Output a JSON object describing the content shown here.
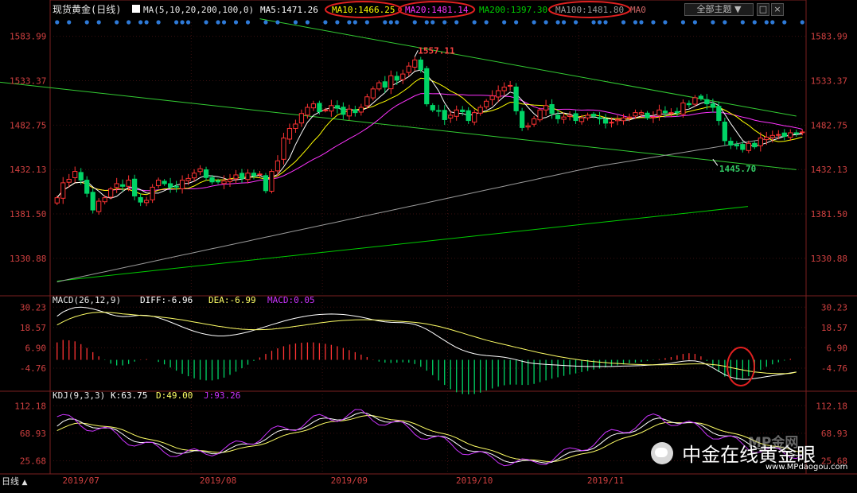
{
  "title": "现货黄金(日线)",
  "main_panel": {
    "ma_indicator_icon": "ma-icon",
    "legend_params": "MA(5,10,20,200,100,0)",
    "legend_items": [
      {
        "label": "MA5:1471.26",
        "color": "#ffffff",
        "circled": false
      },
      {
        "label": "MA10:1466.25",
        "color": "#ffff00",
        "circled": true
      },
      {
        "label": "MA20:1481.14",
        "color": "#ff33ff",
        "circled": true
      },
      {
        "label": "MA200:1397.30",
        "color": "#00cc00",
        "circled": false
      },
      {
        "label": "MA100:1481.80",
        "color": "#9a9a9a",
        "circled": true
      },
      {
        "label": "MA0",
        "color": "#cc6666",
        "circled": false
      }
    ],
    "theme_button": "全部主题",
    "annotations": {
      "high": "1557.11",
      "low": "1445.70"
    }
  },
  "chart_data": [
    {
      "type": "candlestick",
      "title": "现货黄金(日线)",
      "ylim": [
        1290,
        1600
      ],
      "y_ticks": [
        1583.99,
        1533.37,
        1482.75,
        1432.13,
        1381.5,
        1330.88
      ],
      "x_ticks": [
        "2019/07",
        "2019/08",
        "2019/09",
        "2019/10",
        "2019/11"
      ],
      "colors": {
        "up": "#ff3333",
        "down": "#00d466"
      },
      "ohlc_closes": [
        1400,
        1417,
        1421,
        1430,
        1420,
        1405,
        1386,
        1396,
        1400,
        1410,
        1416,
        1413,
        1420,
        1402,
        1395,
        1397,
        1412,
        1420,
        1416,
        1412,
        1412,
        1420,
        1422,
        1428,
        1433,
        1423,
        1418,
        1418,
        1419,
        1421,
        1426,
        1422,
        1428,
        1425,
        1427,
        1408,
        1430,
        1442,
        1468,
        1479,
        1484,
        1496,
        1503,
        1507,
        1498,
        1500,
        1505,
        1502,
        1495,
        1501,
        1497,
        1503,
        1515,
        1524,
        1531,
        1526,
        1539,
        1534,
        1541,
        1550,
        1557,
        1546,
        1507,
        1500,
        1499,
        1489,
        1494,
        1500,
        1498,
        1488,
        1497,
        1503,
        1510,
        1516,
        1522,
        1526,
        1528,
        1499,
        1480,
        1482,
        1490,
        1500,
        1505,
        1496,
        1490,
        1492,
        1494,
        1488,
        1491,
        1494,
        1493,
        1490,
        1485,
        1486,
        1489,
        1491,
        1492,
        1497,
        1497,
        1491,
        1492,
        1500,
        1497,
        1497,
        1497,
        1508,
        1506,
        1514,
        1513,
        1507,
        1503,
        1488,
        1465,
        1460,
        1459,
        1455,
        1462,
        1458,
        1468,
        1469,
        1471,
        1472,
        1470,
        1474,
        1473,
        1475
      ],
      "ma_series": [
        {
          "name": "MA5",
          "color": "#ffffff"
        },
        {
          "name": "MA10",
          "color": "#ffff00"
        },
        {
          "name": "MA20",
          "color": "#ff33ff"
        },
        {
          "name": "MA100",
          "color": "#9a9a9a"
        },
        {
          "name": "MA200",
          "color": "#00cc00",
          "values": [
            1305,
            1390
          ]
        }
      ],
      "channel_lines": [
        {
          "color": "#33cc33",
          "from": [
            -18,
            1538
          ],
          "to": [
            124,
            1432
          ]
        },
        {
          "color": "#33cc33",
          "from": [
            34,
            1604
          ],
          "to": [
            124,
            1493
          ]
        }
      ],
      "markers": {
        "high": {
          "index": 60,
          "value": 1557.11
        },
        "low": {
          "index": 110,
          "value": 1445.7
        }
      }
    },
    {
      "type": "macd",
      "title": "MACD(26,12,9)",
      "params": "MACD(26,12,9)",
      "labels": {
        "diff": "DIFF:-6.96",
        "dea": "DEA:-6.99",
        "macd": "MACD:0.05"
      },
      "ylim": [
        -18,
        34
      ],
      "y_ticks": [
        30.23,
        18.57,
        6.9,
        -4.76
      ],
      "diff": [
        25,
        27.5,
        29,
        30,
        30.2,
        29.9,
        29.2,
        28.3,
        27.2,
        26,
        25.2,
        24.8,
        24.9,
        25.3,
        25.6,
        25.5,
        25,
        24.1,
        23,
        21.7,
        20.3,
        18.9,
        17.6,
        16.4,
        15.4,
        14.6,
        14,
        13.7,
        13.7,
        14,
        14.5,
        15.2,
        16,
        17,
        18,
        19.1,
        20.2,
        21.2,
        22.2,
        23.1,
        23.9,
        24.6,
        25.2,
        25.7,
        26,
        26.2,
        26.3,
        26.2,
        26,
        25.6,
        25.1,
        24.5,
        23.8,
        23,
        22.3,
        21.8,
        21.5,
        21.4,
        21.3,
        21,
        20.3,
        19.1,
        17.5,
        15.5,
        13.3,
        11.1,
        9,
        7.1,
        5.6,
        4.4,
        3.5,
        2.9,
        2.5,
        2.2,
        1.9,
        1.5,
        0.9,
        0.1,
        -0.8,
        -1.6,
        -2.1,
        -2.4,
        -2.6,
        -2.8,
        -3,
        -3.2,
        -3.4,
        -3.6,
        -3.7,
        -3.8,
        -3.8,
        -3.8,
        -3.8,
        -3.8,
        -3.7,
        -3.6,
        -3.5,
        -3.4,
        -3.3,
        -3.1,
        -2.9,
        -2.6,
        -2.3,
        -1.9,
        -1.3,
        -0.8,
        -0.5,
        -0.6,
        -1.3,
        -2.7,
        -4.6,
        -6.6,
        -8.5,
        -9.9,
        -10.8,
        -11.2,
        -11.1,
        -10.7,
        -10.2,
        -9.6,
        -9.1,
        -8.6,
        -8.1,
        -7.5,
        -7
      ],
      "dea": [
        20,
        21.8,
        23.4,
        24.7,
        25.7,
        26.5,
        27,
        27.3,
        27.3,
        27.1,
        26.8,
        26.4,
        26.1,
        25.8,
        25.5,
        25.3,
        25,
        24.7,
        24.3,
        23.9,
        23.4,
        22.9,
        22.3,
        21.7,
        21.1,
        20.5,
        19.9,
        19.3,
        18.8,
        18.3,
        17.9,
        17.6,
        17.4,
        17.3,
        17.3,
        17.4,
        17.6,
        17.9,
        18.3,
        18.7,
        19.2,
        19.7,
        20.2,
        20.7,
        21.2,
        21.6,
        22,
        22.3,
        22.6,
        22.8,
        22.9,
        23,
        23,
        22.9,
        22.8,
        22.6,
        22.4,
        22.2,
        22,
        21.8,
        21.5,
        21.1,
        20.6,
        19.9,
        19.2,
        18.3,
        17.4,
        16.4,
        15.4,
        14.3,
        13.3,
        12.3,
        11.3,
        10.4,
        9.6,
        8.8,
        8,
        7.2,
        6.4,
        5.6,
        4.8,
        4,
        3.3,
        2.6,
        2,
        1.4,
        0.8,
        0.3,
        -0.2,
        -0.6,
        -1,
        -1.3,
        -1.6,
        -1.9,
        -2.1,
        -2.3,
        -2.5,
        -2.6,
        -2.7,
        -2.8,
        -2.8,
        -2.8,
        -2.8,
        -2.7,
        -2.6,
        -2.5,
        -2.4,
        -2.3,
        -2.3,
        -2.4,
        -2.7,
        -3.1,
        -3.7,
        -4.4,
        -5.1,
        -5.8,
        -6.4,
        -6.9,
        -7.3,
        -7.6,
        -7.8,
        -7.9,
        -7.9,
        -7.8,
        -7
      ]
    },
    {
      "type": "kdj",
      "title": "KDJ(9,3,3)",
      "params": "KDJ(9,3,3)",
      "labels": {
        "k": "K:63.75",
        "d": "D:49.00",
        "j": "J:93.26"
      },
      "ylim": [
        10,
        125
      ],
      "y_ticks": [
        112.18,
        68.93,
        25.68
      ],
      "j_cycle": [
        95,
        75,
        50,
        35,
        45,
        70,
        90,
        100,
        80,
        55,
        30,
        20,
        40,
        70
      ]
    }
  ],
  "bottom_bar": {
    "period_tab": "日线"
  },
  "watermark": {
    "brand": "中金在线黄金眼",
    "url": "www.MPdaogou.com",
    "logo_text": "MP金网"
  }
}
